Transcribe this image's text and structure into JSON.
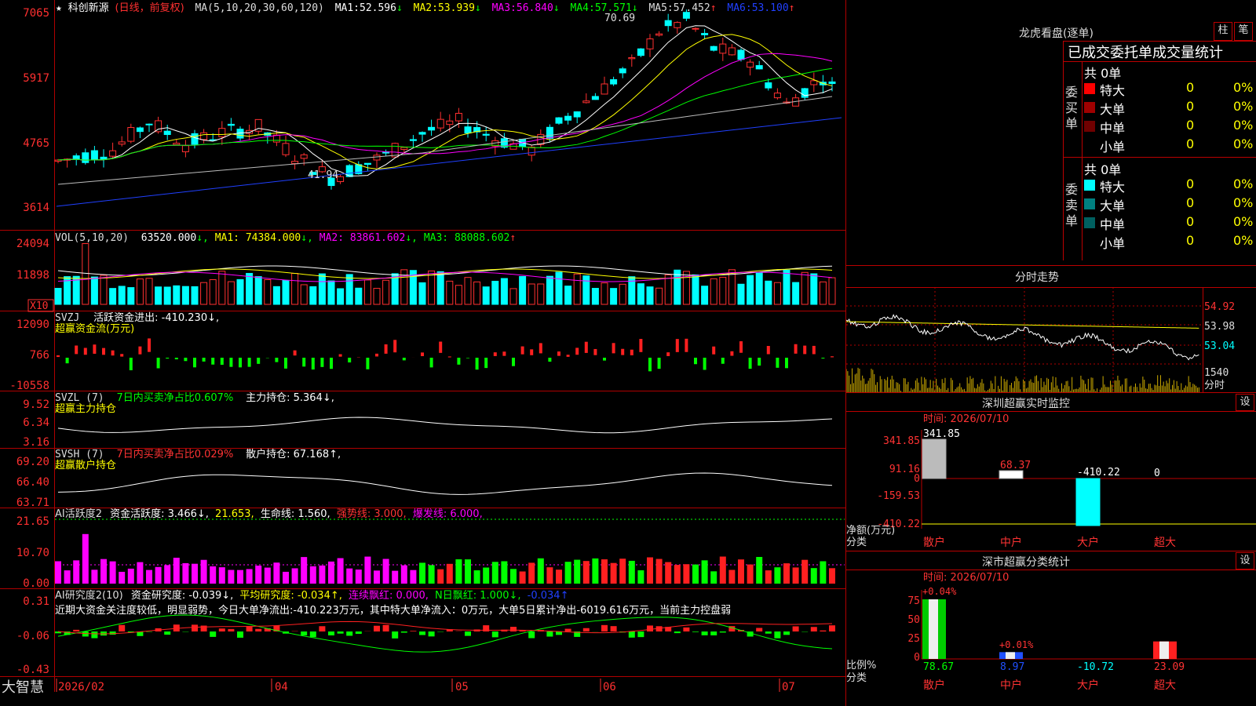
{
  "header": {
    "star": "★",
    "name": "科创新源",
    "mode": "(日线，前复权)",
    "ma_label": "MA(5,10,20,30,60,120)",
    "ma": [
      {
        "label": "MA1:",
        "value": "52.596",
        "arrow": "↓",
        "color": "#ffffff"
      },
      {
        "label": "MA2:",
        "value": "53.939",
        "arrow": "↓",
        "color": "#ffff00"
      },
      {
        "label": "MA3:",
        "value": "56.840",
        "arrow": "↓",
        "color": "#ff00ff"
      },
      {
        "label": "MA4:",
        "value": "57.571",
        "arrow": "↓",
        "color": "#00ff00"
      },
      {
        "label": "MA5:",
        "value": "57.452",
        "arrow": "↑",
        "color": "#bbbbbb"
      },
      {
        "label": "MA6:",
        "value": "53.100",
        "arrow": "↑",
        "color": "#2040ff"
      }
    ]
  },
  "price_axis": [
    "7065",
    "5917",
    "4765",
    "3614"
  ],
  "price_marks": {
    "high": "70.69",
    "low": "41.94"
  },
  "vol": {
    "title": "VOL(5,10,20)",
    "value": "63520.000",
    "ma1": "MA1: 74384.000",
    "ma2": "MA2: 83861.602",
    "ma3": "MA3: 88088.602",
    "axis": [
      "24094",
      "11898"
    ],
    "unit": "X10"
  },
  "svzj": {
    "title": "SVZJ",
    "label": "活跃资金进出: -410.230↓,",
    "sub": "超赢资金流(万元)",
    "axis": [
      "12090",
      "766",
      "-10558"
    ]
  },
  "svzl": {
    "title": "SVZL (7)",
    "label1": "7日内买卖净占比0.607%",
    "label2": "主力持仓: 5.364↓,",
    "sub": "超赢主力持仓",
    "axis": [
      "9.52",
      "6.34",
      "3.16"
    ]
  },
  "svsh": {
    "title": "SVSH (7)",
    "label1": "7日内买卖净占比0.029%",
    "label2": "散户持仓: 67.168↑,",
    "sub": "超赢散户持仓",
    "axis": [
      "69.20",
      "66.40",
      "63.71"
    ]
  },
  "ai1": {
    "title": "AI活跃度2",
    "l1": "资金活跃度: 3.466↓,",
    "l2": "21.653,",
    "l3": "生命线: 1.560,",
    "l4": "强势线: 3.000,",
    "l5": "爆发线: 6.000,",
    "axis": [
      "21.65",
      "10.70",
      "0.00"
    ]
  },
  "ai2": {
    "title": "AI研究度2(10)",
    "l1": "资金研究度: -0.039↓,",
    "l2": "平均研究度: -0.034↑,",
    "l3": "连续飘红: 0.000,",
    "l4": "N日飘红: 1.000↓,",
    "l5": "-0.034↑",
    "note": "近期大资金关注度较低，明显弱势，今日大单净流出:-410.223万元，其中特大单净流入：0万元，大单5日累计净出-6019.616万元，当前主力控盘弱",
    "axis": [
      "0.31",
      "-0.06",
      "-0.43"
    ]
  },
  "bottom": {
    "brand": "大智慧",
    "dates": [
      "2026/02",
      "04",
      "05",
      "06",
      "07"
    ]
  },
  "right": {
    "lhb_title": "龙虎看盘(逐单)",
    "btn_zhu": "柱",
    "btn_bi": "笔",
    "stat_title": "已成交委托单成交量统计",
    "buy": {
      "side": "委买单",
      "total": "共 0单",
      "rows": [
        {
          "name": "特大",
          "n": "0",
          "p": "0%",
          "c": "#ff0000"
        },
        {
          "name": "大单",
          "n": "0",
          "p": "0%",
          "c": "#a00000"
        },
        {
          "name": "中单",
          "n": "0",
          "p": "0%",
          "c": "#700000"
        },
        {
          "name": "小单",
          "n": "0",
          "p": "0%",
          "c": "#000000"
        }
      ]
    },
    "sell": {
      "side": "委卖单",
      "total": "共 0单",
      "rows": [
        {
          "name": "特大",
          "n": "0",
          "p": "0%",
          "c": "#00ffff"
        },
        {
          "name": "大单",
          "n": "0",
          "p": "0%",
          "c": "#008080"
        },
        {
          "name": "中单",
          "n": "0",
          "p": "0%",
          "c": "#006060"
        },
        {
          "name": "小单",
          "n": "0",
          "p": "0%",
          "c": "#000000"
        }
      ]
    },
    "fs_title": "分时走势",
    "fs_axis": [
      "54.92",
      "53.98",
      "53.04",
      "1540"
    ],
    "fs_label": "分时",
    "mon_title": "深圳超赢实时监控",
    "mon_set": "设",
    "mon_time": "时间: 2026/07/10",
    "mon_axis": [
      "341.85",
      "91.16",
      "0",
      "-159.53",
      "-410.22"
    ],
    "mon_vals": [
      "341.85",
      "68.37",
      "-410.22",
      "0"
    ],
    "mon_ylabel": "净额(万元)",
    "mon_xlabel": "分类",
    "cats": [
      "散户",
      "中户",
      "大户",
      "超大"
    ],
    "cls_title": "深市超赢分类统计",
    "cls_set": "设",
    "cls_time": "时间: 2026/07/10",
    "cls_axis": [
      "75",
      "50",
      "25",
      "0"
    ],
    "cls_top": [
      "+0.04%",
      "+0.01%"
    ],
    "cls_vals": [
      "78.67",
      "8.97",
      "-10.72",
      "23.09"
    ],
    "cls_ylabel": "比例%",
    "cls_xlabel": "分类"
  },
  "chart_data": {
    "type": "candlestick",
    "title": "科创新源 (日线，前复权)",
    "ylim": [
      35,
      72
    ],
    "high": 70.69,
    "low": 41.94,
    "mini": {
      "type": "bar",
      "title": "深圳超赢实时监控",
      "categories": [
        "散户",
        "中户",
        "大户",
        "超大"
      ],
      "values": [
        341.85,
        68.37,
        -410.22,
        0
      ]
    },
    "ratio": {
      "type": "bar",
      "title": "深市超赢分类统计",
      "categories": [
        "散户",
        "中户",
        "大户",
        "超大"
      ],
      "values": [
        78.67,
        8.97,
        -10.72,
        23.09
      ]
    }
  }
}
